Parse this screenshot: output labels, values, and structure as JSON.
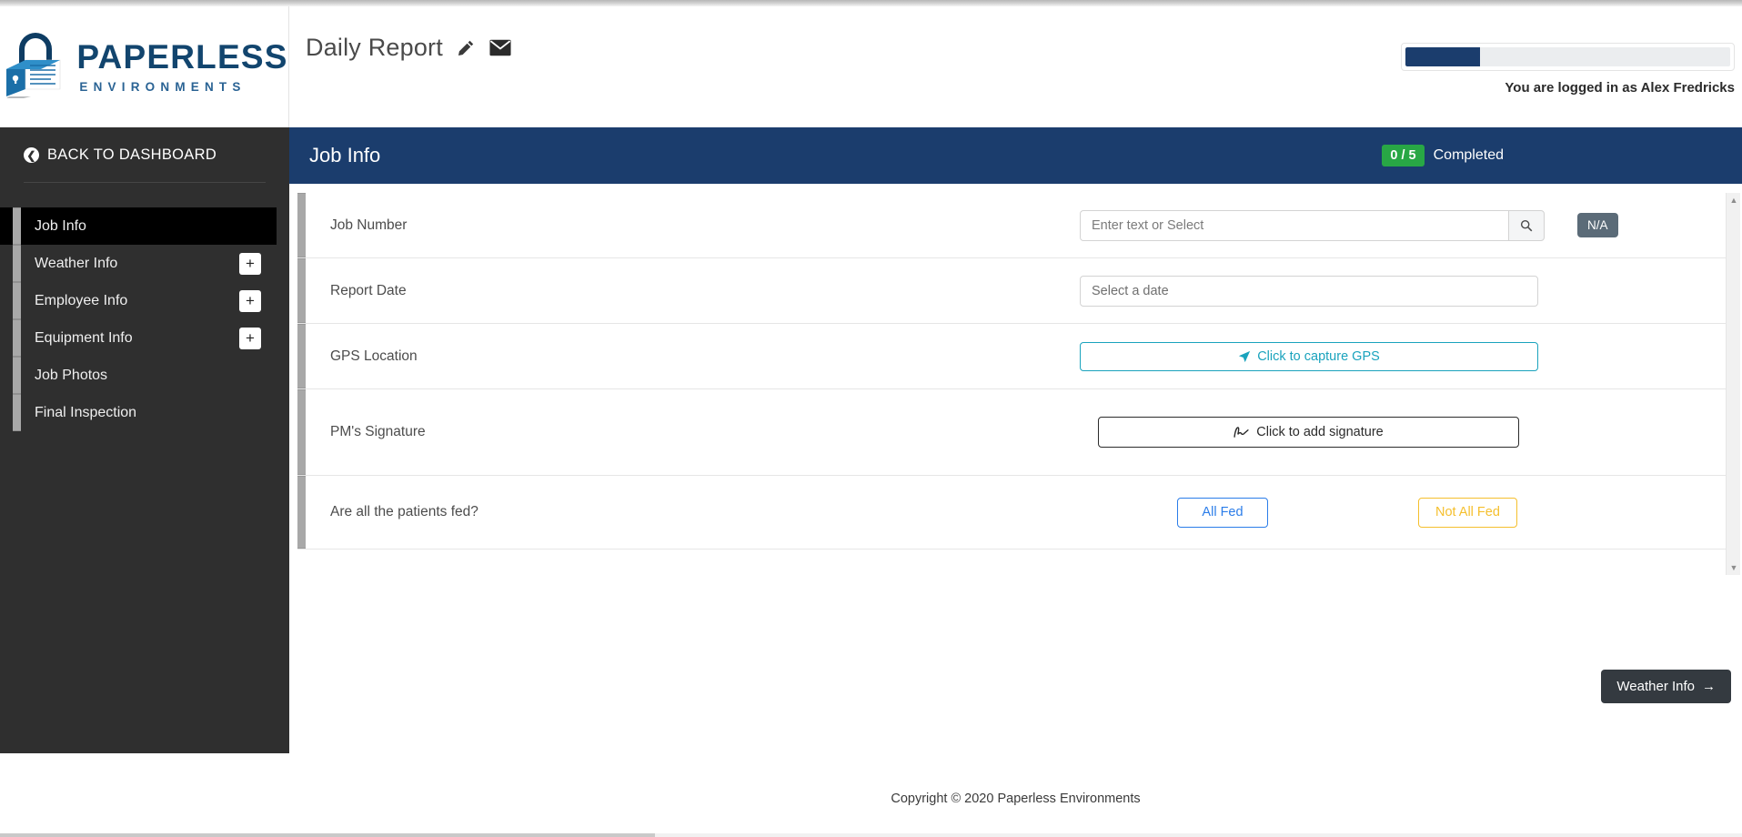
{
  "brand": {
    "name_top": "PAPERLESS",
    "name_sub": "ENVIRONMENTS",
    "logo_icon": "padlock-document-icon"
  },
  "header": {
    "page_title": "Daily Report",
    "edit_icon": "pencil-icon",
    "mail_icon": "envelope-icon",
    "progress_percent": 23,
    "login_text": "You are logged in as Alex Fredricks",
    "progress_color": "#1b3d6d"
  },
  "sidebar": {
    "back_label": "BACK TO DASHBOARD",
    "back_icon": "arrow-circle-left-icon",
    "items": [
      {
        "label": "Job Info",
        "active": true,
        "expandable": false
      },
      {
        "label": "Weather Info",
        "active": false,
        "expandable": true,
        "expand_icon": "plus-icon"
      },
      {
        "label": "Employee Info",
        "active": false,
        "expandable": true,
        "expand_icon": "plus-icon"
      },
      {
        "label": "Equipment Info",
        "active": false,
        "expandable": true,
        "expand_icon": "plus-icon"
      },
      {
        "label": "Job Photos",
        "active": false,
        "expandable": false
      },
      {
        "label": "Final Inspection",
        "active": false,
        "expandable": false
      }
    ]
  },
  "section": {
    "title": "Job Info",
    "completed_count": "0 / 5",
    "completed_label": "Completed",
    "badge_color": "#28a745",
    "bar_color": "#1b3d6d"
  },
  "form": {
    "rows": [
      {
        "label": "Job Number",
        "type": "text-search",
        "value": "",
        "placeholder": "Enter text or Select",
        "search_icon": "search-icon",
        "na_label": "N/A"
      },
      {
        "label": "Report Date",
        "type": "date",
        "value": "",
        "placeholder": "Select a date"
      },
      {
        "label": "GPS Location",
        "type": "gps",
        "button_label": "Click to capture GPS",
        "button_icon": "location-arrow-icon",
        "accent": "#1aa3bd"
      },
      {
        "label": "PM's Signature",
        "type": "signature",
        "button_label": "Click to add signature",
        "button_icon": "signature-icon"
      },
      {
        "label": "Are all the patients fed?",
        "type": "choice",
        "options": [
          {
            "label": "All Fed",
            "color": "#2b7de9"
          },
          {
            "label": "Not All Fed",
            "color": "#f5bf2d"
          }
        ]
      }
    ],
    "scroll_up_icon": "chevron-up-icon",
    "scroll_down_icon": "chevron-down-icon"
  },
  "next_button": {
    "label": "Weather Info",
    "icon": "arrow-right-icon"
  },
  "footer": {
    "copyright": "Copyright © 2020 Paperless Environments"
  }
}
